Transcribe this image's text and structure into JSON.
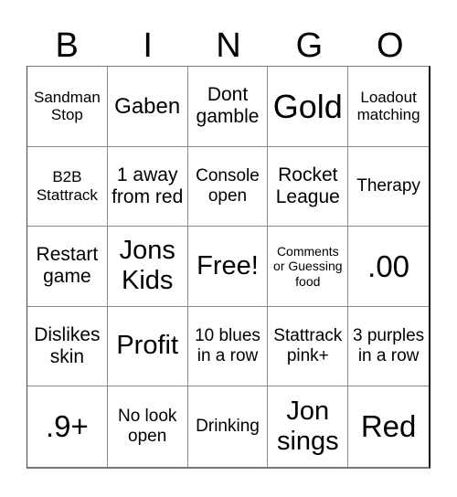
{
  "header": [
    "B",
    "I",
    "N",
    "G",
    "O"
  ],
  "cells": [
    "Sandman Stop",
    "Gaben",
    "Dont gamble",
    "Gold",
    "Loadout matching",
    "B2B Stattrack",
    "1 away from red",
    "Console open",
    "Rocket League",
    "Therapy",
    "Restart game",
    "Jons Kids",
    "Free!",
    "Comments or Guessing food",
    ".00",
    "Dislikes skin",
    "Profit",
    "10 blues in a row",
    "Stattrack pink+",
    "3 purples in a row",
    ".9+",
    "No look open",
    "Drinking",
    "Jon sings",
    "Red"
  ]
}
